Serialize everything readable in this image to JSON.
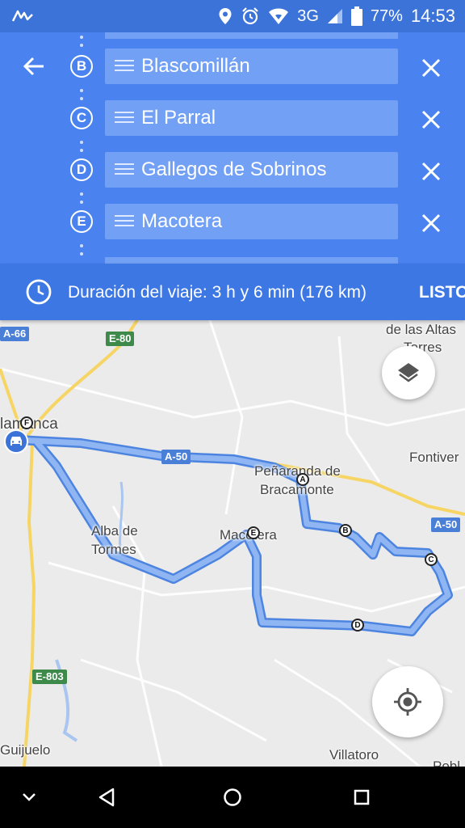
{
  "status_bar": {
    "network": "3G",
    "battery": "77%",
    "time": "14:53",
    "icons": [
      "app-notification-icon",
      "location-icon",
      "alarm-icon",
      "wifi-icon",
      "signal-icon",
      "battery-icon"
    ]
  },
  "header": {
    "back_icon": "arrow-back-icon",
    "stops": [
      {
        "letter": "B",
        "name": "Blascomillán"
      },
      {
        "letter": "C",
        "name": "El Parral"
      },
      {
        "letter": "D",
        "name": "Gallegos de Sobrinos"
      },
      {
        "letter": "E",
        "name": "Macotera"
      }
    ],
    "remove_icon": "close-icon",
    "drag_icon": "drag-handle-icon"
  },
  "duration_bar": {
    "icon": "clock-icon",
    "text": "Duración del viaje: 3 h y 6 min  (176 km)",
    "done_label": "LISTO"
  },
  "map": {
    "places": [
      "de las Altas",
      "Torres",
      "Fontiver",
      "Peñaranda de",
      "Bracamonte",
      "Alba de",
      "Tormes",
      "Macotera",
      "Villatoro",
      "Guijuelo",
      "lamanca",
      "Pobl"
    ],
    "roads": [
      "A-66",
      "E-80",
      "A-50",
      "A-50",
      "E-803"
    ],
    "waypoints": [
      "A",
      "B",
      "C",
      "D",
      "E",
      "F"
    ],
    "route_color": "#7aa7ee",
    "route_edge_color": "#4d84e0",
    "layers_icon": "layers-icon",
    "locate_icon": "my-location-icon"
  },
  "nav_bar": {
    "icons": [
      "chevron-down-icon",
      "back-triangle-icon",
      "home-circle-icon",
      "recents-square-icon"
    ]
  }
}
